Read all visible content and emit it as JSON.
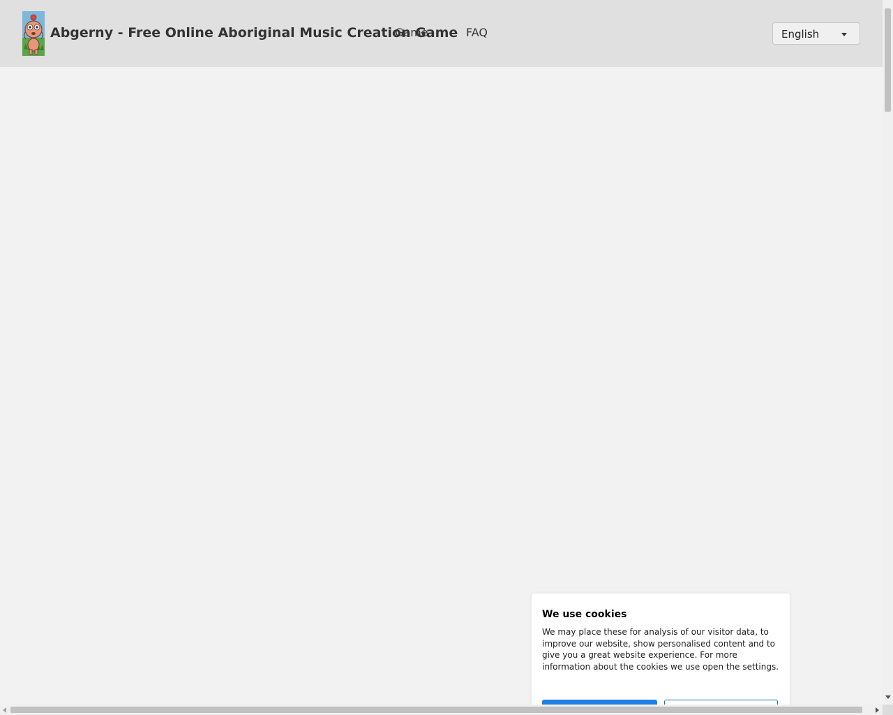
{
  "header": {
    "site_title": "Abgerny - Free Online Aboriginal Music Creation Game",
    "nav": {
      "game_label": "Game",
      "faq_label": "FAQ"
    },
    "language": {
      "selected": "English",
      "caret_icon": "chevron-down-icon"
    },
    "logo_icon": "cartoon-character-logo"
  },
  "cookie_banner": {
    "title": "We use cookies",
    "body": "We may place these for analysis of our visitor data, to improve our website, show personalised content and to give you a great website experience. For more information about the cookies we use open the settings.",
    "accept_label": "",
    "settings_label": ""
  },
  "colors": {
    "header_bg": "#e0e0e0",
    "page_bg": "#f2f2f2",
    "primary_button": "#1f7fe6"
  }
}
